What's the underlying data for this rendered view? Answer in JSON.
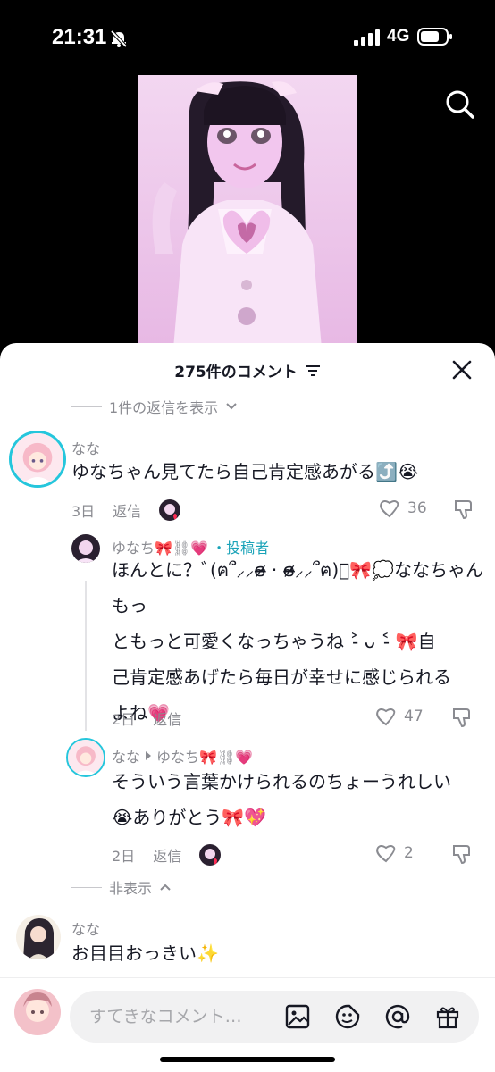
{
  "status_bar": {
    "time": "21:31",
    "network": "4G"
  },
  "sheet": {
    "title": "275件のコメント"
  },
  "collapsed_top": {
    "label": "1件の返信を表示"
  },
  "comments": [
    {
      "username": "なな",
      "text": "ゆなちゃん見てたら自己肯定感あがる⤴️😭",
      "time": "3日",
      "reply_label": "返信",
      "likes": "36"
    },
    {
      "username": "ゆなち🎀⛓💗",
      "author_tag": "・投稿者",
      "text_lines": [
        "ほんとに？ﾞ(ฅ՞⸝⸝ɞ̴̶̷ · ɞ̴̶̷⸝⸝՞ฅ)ﾞ🎀💭ななちゃんもっ",
        "ともっと可愛くなっちゃうね ˃̵ ᴗ ˂̵ 🎀自",
        "己肯定感あげたら毎日が幸せに感じられる",
        "よね💗"
      ],
      "time": "2日",
      "reply_label": "返信",
      "likes": "47"
    },
    {
      "username": "なな",
      "reply_to": "ゆなち🎀⛓💗",
      "text_lines": [
        "そういう言葉かけられるのちょーうれしい",
        "😭ありがとう🎀💖"
      ],
      "time": "2日",
      "reply_label": "返信",
      "likes": "2"
    },
    {
      "username": "なな",
      "text": "お目目おっきい✨"
    }
  ],
  "hide_label": "非表示",
  "input": {
    "placeholder": "すてきなコメント…"
  },
  "icons": {
    "search": "search-icon",
    "close": "close-icon",
    "filter": "filter-icon",
    "like": "heart-icon",
    "dislike": "dislike-icon",
    "image": "image-icon",
    "sticker": "sticker-icon",
    "mention": "at-icon",
    "gift": "gift-icon"
  },
  "colors": {
    "accent": "#1aa3b8",
    "text": "#161823",
    "muted": "#8a8b91"
  }
}
